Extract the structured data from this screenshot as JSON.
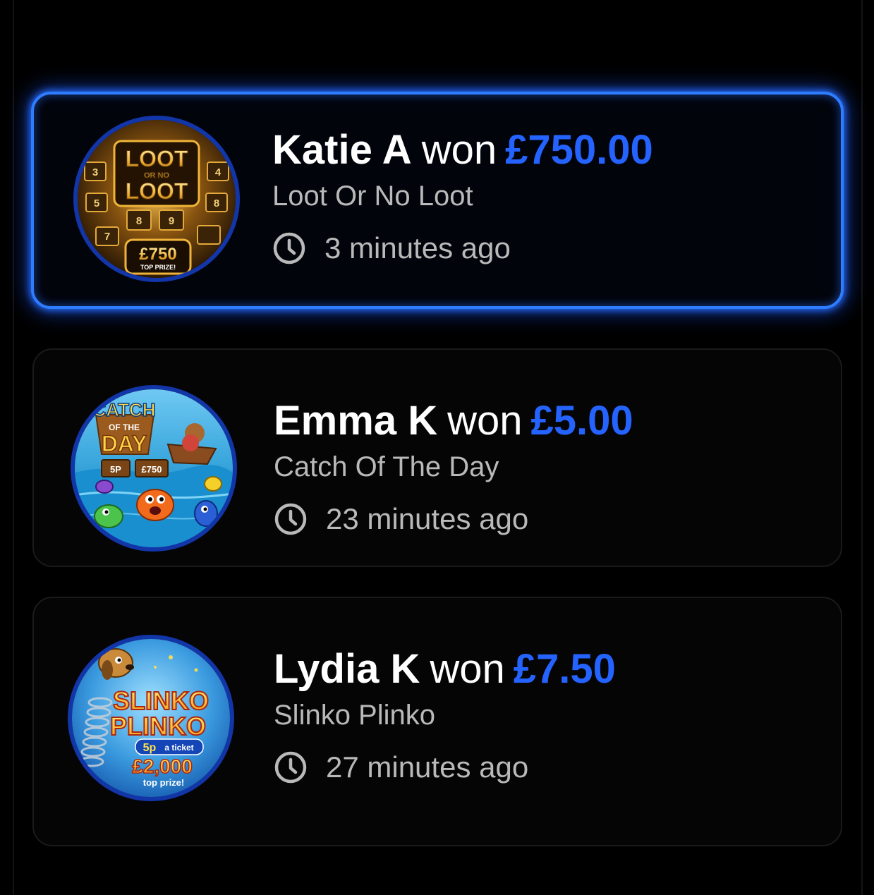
{
  "winners": [
    {
      "name": "Katie A",
      "won_word": "won",
      "amount": "£750.00",
      "game": "Loot Or No Loot",
      "time": "3 minutes ago",
      "highlighted": true,
      "thumbnail": {
        "icon": "loot-or-no-loot-thumbnail",
        "title_top": "LOOT",
        "title_mid": "OR NO",
        "title_bottom": "LOOT",
        "prize": "£750",
        "prize_caption": "TOP PRIZE!",
        "numbers": [
          "3",
          "4",
          "5",
          "8",
          "8",
          "9",
          "7"
        ]
      }
    },
    {
      "name": "Emma K",
      "won_word": "won",
      "amount": "£5.00",
      "game": "Catch Of The Day",
      "time": "23 minutes ago",
      "highlighted": false,
      "thumbnail": {
        "icon": "catch-of-the-day-thumbnail",
        "title_top": "CATCH",
        "title_mid": "OF THE",
        "title_bottom": "DAY",
        "price": "5P",
        "prize": "£750"
      }
    },
    {
      "name": "Lydia K",
      "won_word": "won",
      "amount": "£7.50",
      "game": "Slinko Plinko",
      "time": "27 minutes ago",
      "highlighted": false,
      "thumbnail": {
        "icon": "slinko-plinko-thumbnail",
        "title_top": "SLINKO",
        "title_bottom": "PLINKO",
        "price": "5p",
        "price_caption": "a ticket",
        "prize": "£2,000",
        "prize_caption": "top prize!"
      }
    }
  ],
  "colors": {
    "background": "#000000",
    "highlight_border": "#2f7dff",
    "amount": "#2563ff",
    "secondary_text": "#b9b9b9",
    "thumbnail_ring": "#1235a8"
  },
  "icons": {
    "time": "clock-icon"
  }
}
